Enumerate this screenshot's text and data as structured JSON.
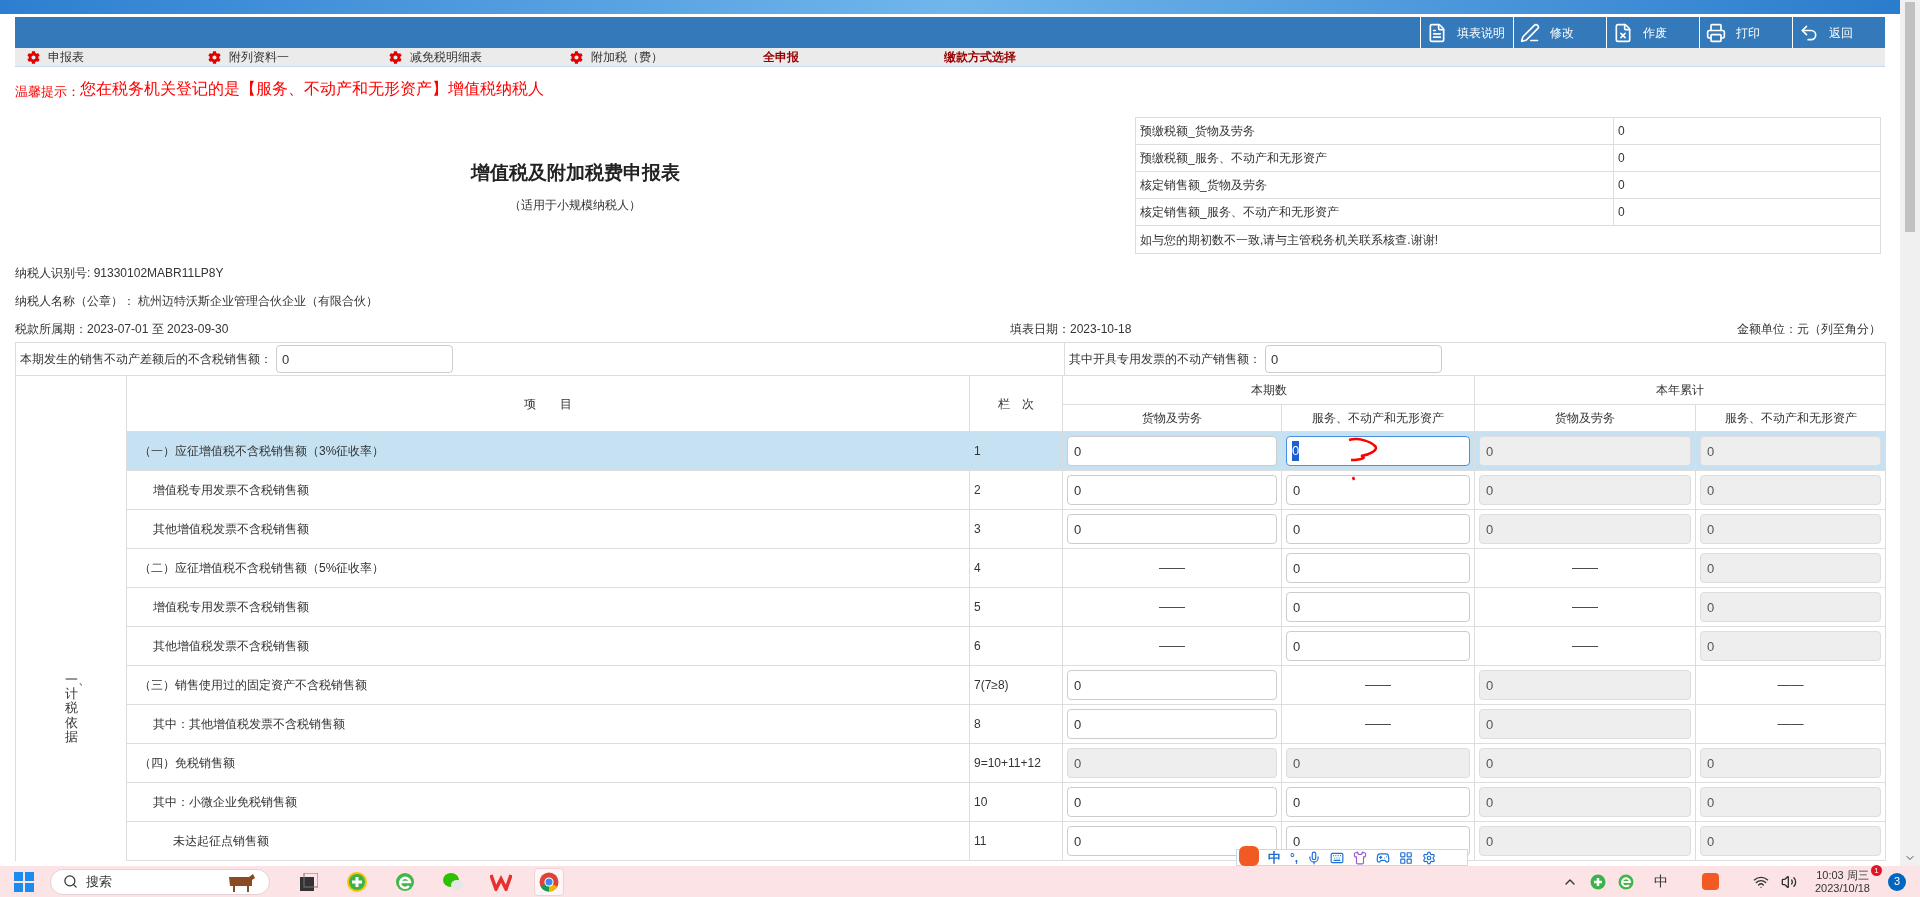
{
  "toolbar": {
    "buttons": [
      {
        "label": "填表说明",
        "kind": "guide"
      },
      {
        "label": "修改",
        "kind": "edit"
      },
      {
        "label": "作废",
        "kind": "void"
      },
      {
        "label": "打印",
        "kind": "print"
      },
      {
        "label": "返回",
        "kind": "back"
      }
    ]
  },
  "tabs": [
    {
      "label": "申报表",
      "kind": "icon"
    },
    {
      "label": "附列资料一",
      "kind": "icon"
    },
    {
      "label": "减免税明细表",
      "kind": "icon"
    },
    {
      "label": "附加税（费）",
      "kind": "icon"
    },
    {
      "label": "全申报",
      "kind": "bold"
    },
    {
      "label": "缴款方式选择",
      "kind": "bold"
    }
  ],
  "notice": {
    "label": "温馨提示：",
    "text": "您在税务机关登记的是【服务、不动产和无形资产】增值税纳税人"
  },
  "title": "增值税及附加税费申报表",
  "subtitle": "（适用于小规模纳税人）",
  "prepaid_table": {
    "rows": [
      {
        "label": "预缴税额_货物及劳务",
        "value": "0"
      },
      {
        "label": "预缴税额_服务、不动产和无形资产",
        "value": "0"
      },
      {
        "label": "核定销售额_货物及劳务",
        "value": "0"
      },
      {
        "label": "核定销售额_服务、不动产和无形资产",
        "value": "0"
      }
    ],
    "note": "如与您的期初数不一致,请与主管税务机关联系核查.谢谢!"
  },
  "taxpayer": {
    "id": "纳税人识别号: 91330102MABR11LP8Y",
    "name": "纳税人名称（公章）： 杭州迈特沃斯企业管理合伙企业（有限合伙）",
    "period": "税款所属期：2023-07-01 至 2023-09-30",
    "fill_date": "填表日期：2023-10-18",
    "unit": "金额单位：元（列至角分）"
  },
  "extra_fields": [
    {
      "label": "本期发生的销售不动产差额后的不含税销售额：",
      "value": "0"
    },
    {
      "label": "其中开具专用发票的不动产销售额：",
      "value": "0"
    }
  ],
  "table": {
    "group_label": "一、计税依据",
    "item_header": "项　　目",
    "line_header": "栏　次",
    "column_groups": [
      {
        "label": "本期数",
        "columns": [
          "货物及劳务",
          "服务、不动产和无形资产"
        ]
      },
      {
        "label": "本年累计",
        "columns": [
          "货物及劳务",
          "服务、不动产和无形资产"
        ]
      }
    ],
    "rows": [
      {
        "item": "（一）应征增值税不含税销售额（3%征收率）",
        "line": "1",
        "selected": true,
        "cells": [
          {
            "kind": "input",
            "value": "0"
          },
          {
            "kind": "focused",
            "value": "0"
          },
          {
            "kind": "disabled",
            "value": "0"
          },
          {
            "kind": "disabled",
            "value": "0"
          }
        ],
        "children": [
          {
            "item": "增值税专用发票不含税销售额",
            "line": "2",
            "selected": false,
            "cells": [
              {
                "kind": "input",
                "value": "0"
              },
              {
                "kind": "input",
                "value": "0"
              },
              {
                "kind": "disabled",
                "value": "0"
              },
              {
                "kind": "disabled",
                "value": "0"
              }
            ]
          },
          {
            "item": "其他增值税发票不含税销售额",
            "line": "3",
            "selected": false,
            "cells": [
              {
                "kind": "input",
                "value": "0"
              },
              {
                "kind": "input",
                "value": "0"
              },
              {
                "kind": "disabled",
                "value": "0"
              },
              {
                "kind": "disabled",
                "value": "0"
              }
            ]
          }
        ]
      },
      {
        "item": "（二）应征增值税不含税销售额（5%征收率）",
        "line": "4",
        "selected": false,
        "cells": [
          {
            "kind": "dash",
            "value": "——"
          },
          {
            "kind": "input",
            "value": "0"
          },
          {
            "kind": "dash",
            "value": "——"
          },
          {
            "kind": "disabled",
            "value": "0"
          }
        ],
        "children": [
          {
            "item": "增值税专用发票不含税销售额",
            "line": "5",
            "selected": false,
            "cells": [
              {
                "kind": "dash",
                "value": "——"
              },
              {
                "kind": "input",
                "value": "0"
              },
              {
                "kind": "dash",
                "value": "——"
              },
              {
                "kind": "disabled",
                "value": "0"
              }
            ]
          },
          {
            "item": "其他增值税发票不含税销售额",
            "line": "6",
            "selected": false,
            "cells": [
              {
                "kind": "dash",
                "value": "——"
              },
              {
                "kind": "input",
                "value": "0"
              },
              {
                "kind": "dash",
                "value": "——"
              },
              {
                "kind": "disabled",
                "value": "0"
              }
            ]
          }
        ]
      },
      {
        "item": "（三）销售使用过的固定资产不含税销售额",
        "line": "7(7≥8)",
        "selected": false,
        "cells": [
          {
            "kind": "input",
            "value": "0"
          },
          {
            "kind": "dash",
            "value": "——"
          },
          {
            "kind": "disabled",
            "value": "0"
          },
          {
            "kind": "dash",
            "value": "——"
          }
        ],
        "children": [
          {
            "item": "其中：其他增值税发票不含税销售额",
            "line": "8",
            "selected": false,
            "cells": [
              {
                "kind": "input",
                "value": "0"
              },
              {
                "kind": "dash",
                "value": "——"
              },
              {
                "kind": "disabled",
                "value": "0"
              },
              {
                "kind": "dash",
                "value": "——"
              }
            ]
          }
        ]
      },
      {
        "item": "（四）免税销售额",
        "line": "9=10+11+12",
        "selected": false,
        "cells": [
          {
            "kind": "disabled",
            "value": "0"
          },
          {
            "kind": "disabled",
            "value": "0"
          },
          {
            "kind": "disabled",
            "value": "0"
          },
          {
            "kind": "disabled",
            "value": "0"
          }
        ],
        "children": [
          {
            "item": "其中：小微企业免税销售额",
            "line": "10",
            "selected": false,
            "cells": [
              {
                "kind": "input",
                "value": "0"
              },
              {
                "kind": "input",
                "value": "0"
              },
              {
                "kind": "disabled",
                "value": "0"
              },
              {
                "kind": "disabled",
                "value": "0"
              }
            ],
            "children": [
              {
                "item": "未达起征点销售额",
                "line": "11",
                "selected": false,
                "cells": [
                  {
                    "kind": "input",
                    "value": "0"
                  },
                  {
                    "kind": "input",
                    "value": "0"
                  },
                  {
                    "kind": "disabled",
                    "value": "0"
                  },
                  {
                    "kind": "disabled",
                    "value": "0"
                  }
                ]
              }
            ]
          }
        ]
      }
    ]
  },
  "ime_toolbar": {
    "mode": "中",
    "punctuation": "°,"
  },
  "taskbar": {
    "search_placeholder": "搜索",
    "apps": [
      {
        "kind": "taskview",
        "selected": false
      },
      {
        "kind": "plus",
        "selected": false
      },
      {
        "kind": "browser",
        "selected": false
      },
      {
        "kind": "chat",
        "selected": false
      },
      {
        "kind": "office",
        "selected": false
      },
      {
        "kind": "chrome",
        "selected": true
      }
    ],
    "tray": {
      "ime": "中",
      "time": "10:03 周三",
      "date": "2023/10/18",
      "time_badge": "1",
      "notifications": "3"
    }
  }
}
